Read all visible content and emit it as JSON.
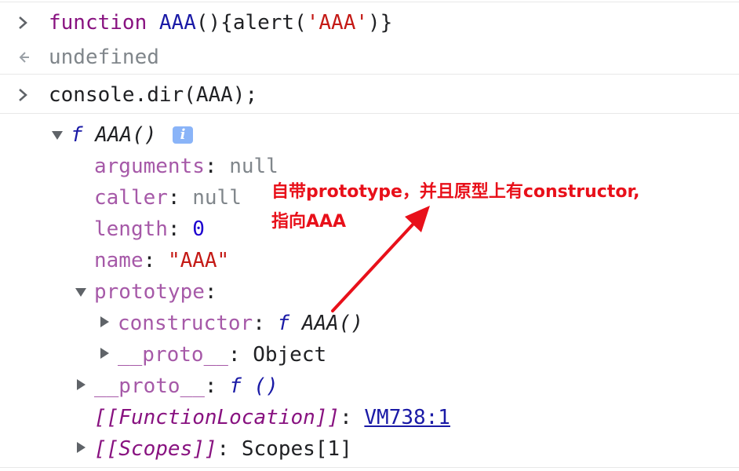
{
  "console": {
    "input1": {
      "keyword": "function",
      "name": "AAA",
      "body_open": "(){alert(",
      "string": "'AAA'",
      "body_close": ")}"
    },
    "output1": {
      "value": "undefined"
    },
    "input2": {
      "text": "console.dir(AAA);"
    },
    "tree": {
      "root_f": "f",
      "root_name": "AAA()",
      "info_icon": "i",
      "arguments_key": "arguments",
      "arguments_val": "null",
      "caller_key": "caller",
      "caller_val": "null",
      "length_key": "length",
      "length_val": "0",
      "name_key": "name",
      "name_val": "\"AAA\"",
      "prototype_key": "prototype",
      "constructor_key": "constructor",
      "constructor_f": "f",
      "constructor_val": "AAA()",
      "proto1_key": "__proto__",
      "proto1_val": "Object",
      "proto2_key": "__proto__",
      "proto2_val": "f ()",
      "fl_key": "[[FunctionLocation]]",
      "fl_val": "VM738:1",
      "scopes_key": "[[Scopes]]",
      "scopes_val": "Scopes[1]"
    },
    "colon": ":"
  },
  "annotation": {
    "line1": "自带prototype，并且原型上有constructor,",
    "line2": "指向AAA",
    "color": "#e8101a"
  },
  "icons": {
    "input_prompt": "chevron-right-icon",
    "result_prompt": "result-arrow-icon",
    "expanded": "triangle-down-icon",
    "collapsed": "triangle-right-icon",
    "info": "info-icon"
  }
}
